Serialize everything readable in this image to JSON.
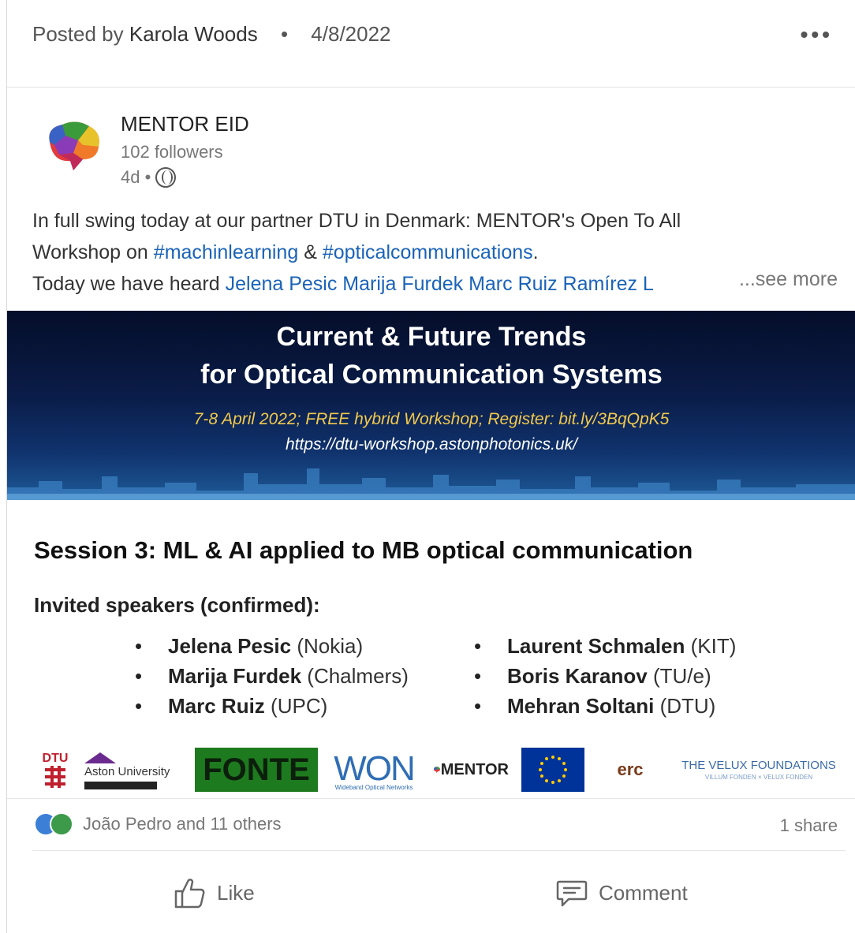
{
  "header": {
    "posted_prefix": "Posted by",
    "author": "Karola Woods",
    "separator": "•",
    "date": "4/8/2022",
    "more_label": "•••"
  },
  "company": {
    "name": "MENTOR EID",
    "followers": "102 followers",
    "age": "4d •"
  },
  "post": {
    "line1": "In full swing today at our partner DTU in Denmark: MENTOR's Open To All",
    "line2_prefix": "Workshop on ",
    "tag1": "#machinlearning",
    "line2_mid": " & ",
    "tag2": "#opticalcommunications",
    "line2_suffix": ".",
    "line3_prefix": "Today we have heard ",
    "mentions": "Jelena Pesic Marija Furdek Marc Ruiz Ramírez L",
    "see_more": "...see more"
  },
  "banner": {
    "title_line1": "Current & Future Trends",
    "title_line2": "for Optical Communication Systems",
    "subtitle": "7-8 April 2022; FREE hybrid Workshop; Register:  bit.ly/3BqQpK5",
    "url": "https://dtu-workshop.astonphotonics.uk/"
  },
  "session": {
    "title": "Session 3: ML & AI applied to MB optical communication",
    "invited_label": "Invited speakers (confirmed):",
    "speakers_left": [
      {
        "name": "Jelena Pesic",
        "org": " (Nokia)"
      },
      {
        "name": "Marija Furdek",
        "org": " (Chalmers)"
      },
      {
        "name": "Marc Ruiz",
        "org": " (UPC)"
      }
    ],
    "speakers_right": [
      {
        "name": "Laurent Schmalen",
        "org": " (KIT)"
      },
      {
        "name": "Boris Karanov",
        "org": " (TU/e)"
      },
      {
        "name": "Mehran Soltani",
        "org": " (DTU)"
      }
    ]
  },
  "logos": {
    "dtu": "DTU",
    "aston": "Aston University",
    "fonte": "FONTE",
    "won": "WON",
    "won_sub": "Wideband Optical Networks",
    "mentor": "MENTOR",
    "erc": "erc",
    "velux": "THE VELUX FOUNDATIONS",
    "velux_sub": "VILLUM FONDEN × VELUX FONDEN"
  },
  "social": {
    "reactions": "João Pedro and 11 others",
    "shares": "1 share"
  },
  "actions": {
    "like": "Like",
    "comment": "Comment"
  },
  "colors": {
    "link": "#1a63b8",
    "banner_accent": "#f2c94c",
    "fonte_green": "#1e7a1e",
    "eu_blue": "#003399"
  }
}
